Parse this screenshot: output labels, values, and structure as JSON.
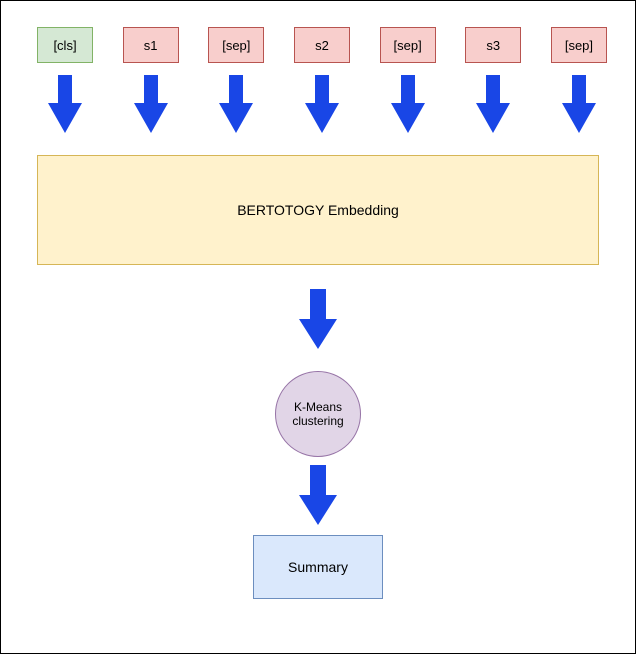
{
  "tokens": [
    {
      "label": "[cls]",
      "style": "green"
    },
    {
      "label": "s1",
      "style": "pink"
    },
    {
      "label": "[sep]",
      "style": "pink"
    },
    {
      "label": "s2",
      "style": "pink"
    },
    {
      "label": "[sep]",
      "style": "pink"
    },
    {
      "label": "s3",
      "style": "pink"
    },
    {
      "label": "[sep]",
      "style": "pink"
    }
  ],
  "embedding": {
    "label": "BERTOTOGY Embedding"
  },
  "cluster": {
    "label": "K-Means\nclustering"
  },
  "summary": {
    "label": "Summary"
  }
}
